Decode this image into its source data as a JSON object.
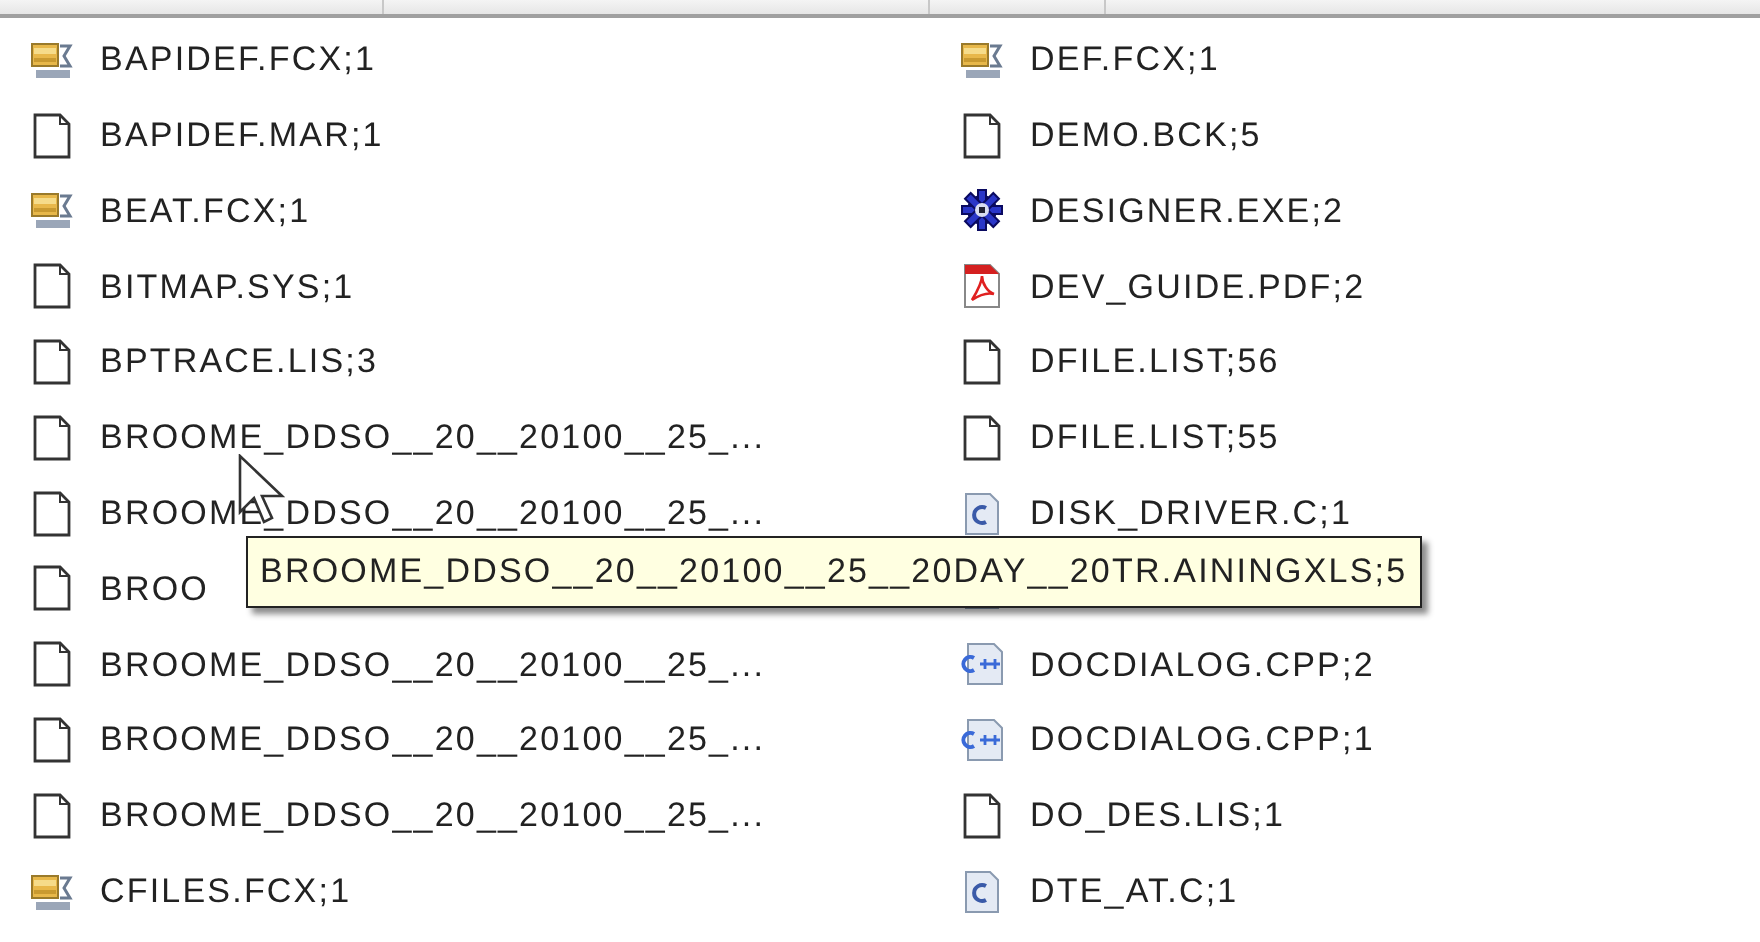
{
  "columns": [
    {
      "files": [
        {
          "kind": "fcx",
          "name": "BAPIDEF.FCX;1"
        },
        {
          "kind": "file",
          "name": "BAPIDEF.MAR;1"
        },
        {
          "kind": "fcx",
          "name": "BEAT.FCX;1"
        },
        {
          "kind": "file",
          "name": "BITMAP.SYS;1"
        },
        {
          "kind": "file",
          "name": "BPTRACE.LIS;3"
        },
        {
          "kind": "file",
          "name": "BROOME_DDSO__20__20100__25_..."
        },
        {
          "kind": "file",
          "name": "BROOME_DDSO__20__20100__25_..."
        },
        {
          "kind": "file",
          "name": "BROO"
        },
        {
          "kind": "file",
          "name": "BROOME_DDSO__20__20100__25_..."
        },
        {
          "kind": "file",
          "name": "BROOME_DDSO__20__20100__25_..."
        },
        {
          "kind": "file",
          "name": "BROOME_DDSO__20__20100__25_..."
        },
        {
          "kind": "fcx",
          "name": "CFILES.FCX;1"
        }
      ]
    },
    {
      "files": [
        {
          "kind": "fcx",
          "name": "DEF.FCX;1"
        },
        {
          "kind": "file",
          "name": "DEMO.BCK;5"
        },
        {
          "kind": "exe",
          "name": "DESIGNER.EXE;2"
        },
        {
          "kind": "pdf",
          "name": "DEV_GUIDE.PDF;2"
        },
        {
          "kind": "file",
          "name": "DFILE.LIST;56"
        },
        {
          "kind": "file",
          "name": "DFILE.LIST;55"
        },
        {
          "kind": "c",
          "name": "DISK_DRIVER.C;1"
        },
        {
          "kind": "c"
        },
        {
          "kind": "cpp",
          "name": "DOCDIALOG.CPP;2"
        },
        {
          "kind": "cpp",
          "name": "DOCDIALOG.CPP;1"
        },
        {
          "kind": "file",
          "name": "DO_DES.LIS;1"
        },
        {
          "kind": "c",
          "name": "DTE_AT.C;1"
        }
      ]
    }
  ],
  "tooltip": {
    "text": "BROOME_DDSO__20__20100__25__20DAY__20TR.AININGXLS;5"
  }
}
